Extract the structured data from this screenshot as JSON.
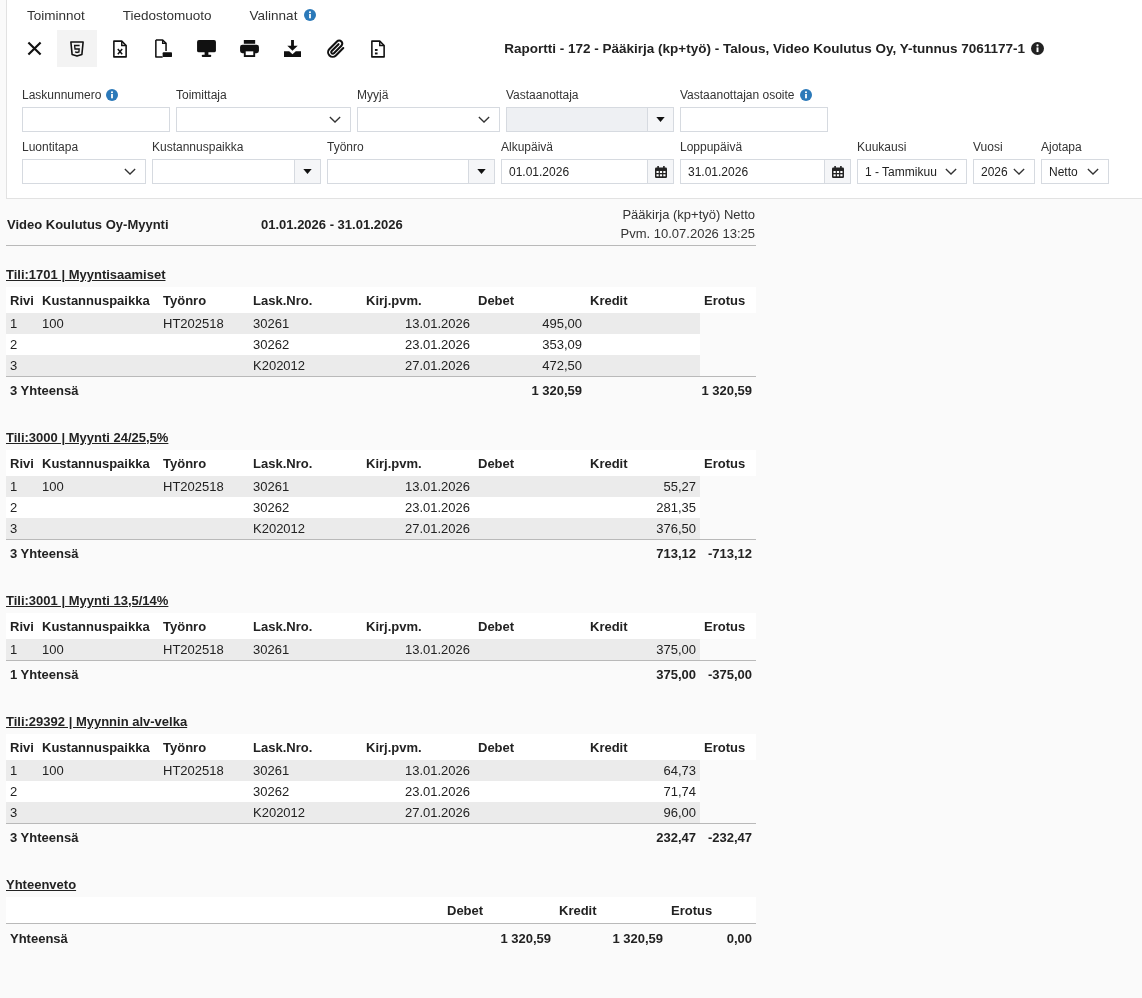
{
  "menu": [
    {
      "label": "Toiminnot",
      "info": false
    },
    {
      "label": "Tiedostomuoto",
      "info": false
    },
    {
      "label": "Valinnat",
      "info": true
    }
  ],
  "toolbar": [
    {
      "kind": "close",
      "selected": false
    },
    {
      "kind": "html",
      "selected": true
    },
    {
      "kind": "excel",
      "selected": false
    },
    {
      "kind": "pdf",
      "selected": false
    },
    {
      "kind": "screen",
      "selected": false
    },
    {
      "kind": "print",
      "selected": false
    },
    {
      "kind": "download",
      "selected": false
    },
    {
      "kind": "attach",
      "selected": false
    },
    {
      "kind": "file",
      "selected": false
    }
  ],
  "report_title": {
    "text": "Raportti - 172 - Pääkirja (kp+työ) - Talous, Video Koulutus Oy, Y-tunnus 7061177-1",
    "info": true
  },
  "filter_rows": [
    [
      {
        "label": "Laskunnumero",
        "kind": "text",
        "info": true,
        "disabled": false
      },
      {
        "label": "Toimittaja",
        "kind": "select",
        "info": false,
        "disabled": false
      },
      {
        "label": "Myyjä",
        "kind": "select",
        "info": false,
        "disabled": false
      },
      {
        "label": "Vastaanottaja",
        "kind": "combo",
        "info": false,
        "disabled": true
      },
      {
        "label": "Vastaanottajan osoite",
        "kind": "text",
        "info": true,
        "disabled": false
      }
    ],
    [
      {
        "label": "Luontitapa",
        "kind": "select",
        "info": false,
        "disabled": false
      },
      {
        "label": "Kustannuspaikka",
        "kind": "combo",
        "info": false,
        "disabled": false
      },
      {
        "label": "Työnro",
        "kind": "combo",
        "info": false,
        "disabled": false
      },
      {
        "label": "Alkupäivä",
        "kind": "date",
        "value": "01.01.2026",
        "info": false,
        "disabled": false
      },
      {
        "label": "Loppupäivä",
        "kind": "date",
        "value": "31.01.2026",
        "info": false,
        "disabled": false
      },
      {
        "label": "Kuukausi",
        "kind": "select",
        "value": "1 - Tammikuu",
        "info": false,
        "disabled": false
      },
      {
        "label": "Vuosi",
        "kind": "select",
        "value": "2026",
        "info": false,
        "disabled": false
      },
      {
        "label": "Ajotapa",
        "kind": "select",
        "value": "Netto",
        "info": false,
        "disabled": false
      }
    ]
  ],
  "report": {
    "company": "Video Koulutus Oy-Myynti",
    "period": "01.01.2026 - 31.01.2026",
    "name": "Pääkirja (kp+työ) Netto",
    "printed": "Pvm. 10.07.2026 13:25"
  },
  "accounts": [
    {
      "title": "Tili:1701 | Myyntisaamiset",
      "columns": [
        "Rivi",
        "Kustannuspaikka",
        "Työnro",
        "Lask.Nro.",
        "Kirj.pvm.",
        "Debet",
        "Kredit",
        "Erotus"
      ],
      "rows": [
        {
          "rivi": "1",
          "kustannuspaikka": "100",
          "tyonro": "HT202518",
          "lask_nro": "30261",
          "kirj_pvm": "13.01.2026",
          "debet": "495,00"
        },
        {
          "rivi": "2",
          "lask_nro": "30262",
          "kirj_pvm": "23.01.2026",
          "debet": "353,09"
        },
        {
          "rivi": "3",
          "lask_nro": "K202012",
          "kirj_pvm": "27.01.2026",
          "debet": "472,50"
        }
      ],
      "total": {
        "label": "3 Yhteensä",
        "debet": "1 320,59",
        "erotus": "1 320,59"
      }
    },
    {
      "title": "Tili:3000 | Myynti 24/25,5%",
      "columns": [
        "Rivi",
        "Kustannuspaikka",
        "Työnro",
        "Lask.Nro.",
        "Kirj.pvm.",
        "Debet",
        "Kredit",
        "Erotus"
      ],
      "rows": [
        {
          "rivi": "1",
          "kustannuspaikka": "100",
          "tyonro": "HT202518",
          "lask_nro": "30261",
          "kirj_pvm": "13.01.2026",
          "kredit": "55,27"
        },
        {
          "rivi": "2",
          "lask_nro": "30262",
          "kirj_pvm": "23.01.2026",
          "kredit": "281,35"
        },
        {
          "rivi": "3",
          "lask_nro": "K202012",
          "kirj_pvm": "27.01.2026",
          "kredit": "376,50"
        }
      ],
      "total": {
        "label": "3 Yhteensä",
        "kredit": "713,12",
        "erotus": "-713,12"
      }
    },
    {
      "title": "Tili:3001 | Myynti 13,5/14%",
      "columns": [
        "Rivi",
        "Kustannuspaikka",
        "Työnro",
        "Lask.Nro.",
        "Kirj.pvm.",
        "Debet",
        "Kredit",
        "Erotus"
      ],
      "rows": [
        {
          "rivi": "1",
          "kustannuspaikka": "100",
          "tyonro": "HT202518",
          "lask_nro": "30261",
          "kirj_pvm": "13.01.2026",
          "kredit": "375,00"
        }
      ],
      "total": {
        "label": "1 Yhteensä",
        "kredit": "375,00",
        "erotus": "-375,00"
      }
    },
    {
      "title": "Tili:29392 | Myynnin alv-velka",
      "columns": [
        "Rivi",
        "Kustannuspaikka",
        "Työnro",
        "Lask.Nro.",
        "Kirj.pvm.",
        "Debet",
        "Kredit",
        "Erotus"
      ],
      "rows": [
        {
          "rivi": "1",
          "kustannuspaikka": "100",
          "tyonro": "HT202518",
          "lask_nro": "30261",
          "kirj_pvm": "13.01.2026",
          "kredit": "64,73"
        },
        {
          "rivi": "2",
          "lask_nro": "30262",
          "kirj_pvm": "23.01.2026",
          "kredit": "71,74"
        },
        {
          "rivi": "3",
          "lask_nro": "K202012",
          "kirj_pvm": "27.01.2026",
          "kredit": "96,00"
        }
      ],
      "total": {
        "label": "3 Yhteensä",
        "kredit": "232,47",
        "erotus": "-232,47"
      }
    }
  ],
  "summary": {
    "title": "Yhteenveto",
    "columns": [
      "Debet",
      "Kredit",
      "Erotus"
    ],
    "total": {
      "label": "Yhteensä",
      "values": [
        "1 320,59",
        "1 320,59",
        "0,00"
      ]
    }
  }
}
